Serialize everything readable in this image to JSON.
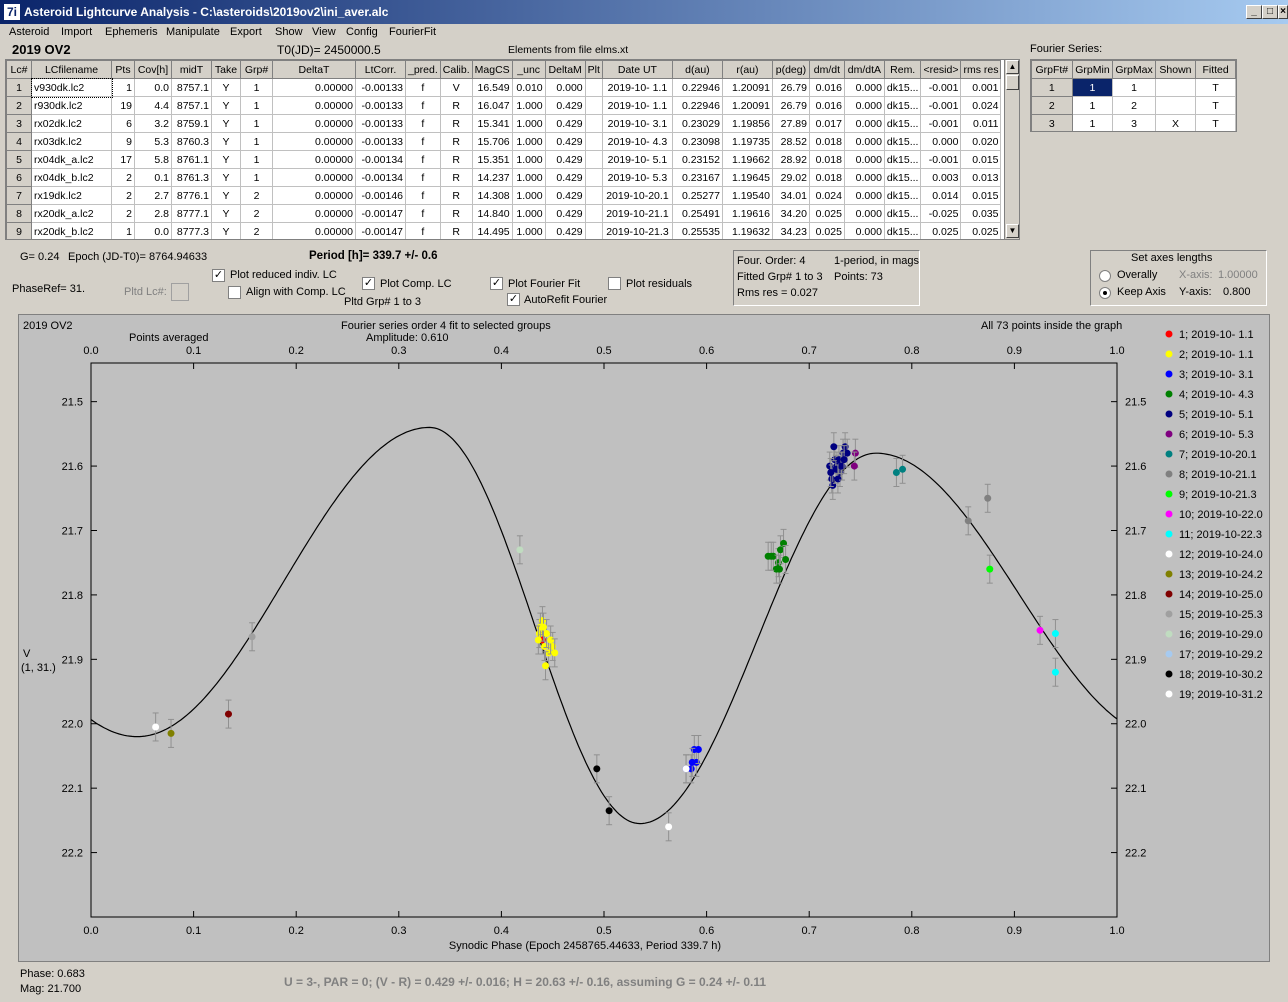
{
  "window": {
    "title": "Asteroid Lightcurve Analysis - C:\\asteroids\\2019ov2\\ini_aver.alc",
    "icon": "7i",
    "min": "_",
    "max": "□",
    "close": "×"
  },
  "menu": [
    "Asteroid",
    "Import",
    "Ephemeris",
    "Manipulate",
    "Export",
    "Show",
    "View",
    "Config",
    "FourierFit"
  ],
  "header": {
    "asteroid": "2019 OV2",
    "t0": "T0(JD)= 2450000.5",
    "elements": "Elements from file elms.xt",
    "fourier_series_label": "Fourier Series:"
  },
  "lc_table": {
    "columns": [
      "Lc#",
      "LCfilename",
      "Pts",
      "Cov[h]",
      "midT",
      "Take",
      "Grp#",
      "DeltaT",
      "LtCorr.",
      "_pred.",
      "Calib.",
      "MagCS",
      "_unc",
      "DeltaM",
      "Plt",
      "Date UT",
      "d(au)",
      "r(au)",
      "p(deg)",
      "dm/dt",
      "dm/dtA",
      "Rem.",
      "<resid>",
      "rms res"
    ],
    "rows": [
      [
        "1",
        "v930dk.lc2",
        "1",
        "0.0",
        "8757.1",
        "Y",
        "1",
        "0.00000",
        "-0.00133",
        "f",
        "V",
        "16.549",
        "0.010",
        "0.000",
        "",
        "2019-10- 1.1",
        "0.22946",
        "1.20091",
        "26.79",
        "0.016",
        "0.000",
        "dk15...",
        "-0.001",
        "0.001"
      ],
      [
        "2",
        "r930dk.lc2",
        "19",
        "4.4",
        "8757.1",
        "Y",
        "1",
        "0.00000",
        "-0.00133",
        "f",
        "R",
        "16.047",
        "1.000",
        "0.429",
        "",
        "2019-10- 1.1",
        "0.22946",
        "1.20091",
        "26.79",
        "0.016",
        "0.000",
        "dk15...",
        "-0.001",
        "0.024"
      ],
      [
        "3",
        "rx02dk.lc2",
        "6",
        "3.2",
        "8759.1",
        "Y",
        "1",
        "0.00000",
        "-0.00133",
        "f",
        "R",
        "15.341",
        "1.000",
        "0.429",
        "",
        "2019-10- 3.1",
        "0.23029",
        "1.19856",
        "27.89",
        "0.017",
        "0.000",
        "dk15...",
        "-0.001",
        "0.011"
      ],
      [
        "4",
        "rx03dk.lc2",
        "9",
        "5.3",
        "8760.3",
        "Y",
        "1",
        "0.00000",
        "-0.00133",
        "f",
        "R",
        "15.706",
        "1.000",
        "0.429",
        "",
        "2019-10- 4.3",
        "0.23098",
        "1.19735",
        "28.52",
        "0.018",
        "0.000",
        "dk15...",
        "0.000",
        "0.020"
      ],
      [
        "5",
        "rx04dk_a.lc2",
        "17",
        "5.8",
        "8761.1",
        "Y",
        "1",
        "0.00000",
        "-0.00134",
        "f",
        "R",
        "15.351",
        "1.000",
        "0.429",
        "",
        "2019-10- 5.1",
        "0.23152",
        "1.19662",
        "28.92",
        "0.018",
        "0.000",
        "dk15...",
        "-0.001",
        "0.015"
      ],
      [
        "6",
        "rx04dk_b.lc2",
        "2",
        "0.1",
        "8761.3",
        "Y",
        "1",
        "0.00000",
        "-0.00134",
        "f",
        "R",
        "14.237",
        "1.000",
        "0.429",
        "",
        "2019-10- 5.3",
        "0.23167",
        "1.19645",
        "29.02",
        "0.018",
        "0.000",
        "dk15...",
        "0.003",
        "0.013"
      ],
      [
        "7",
        "rx19dk.lc2",
        "2",
        "2.7",
        "8776.1",
        "Y",
        "2",
        "0.00000",
        "-0.00146",
        "f",
        "R",
        "14.308",
        "1.000",
        "0.429",
        "",
        "2019-10-20.1",
        "0.25277",
        "1.19540",
        "34.01",
        "0.024",
        "0.000",
        "dk15...",
        "0.014",
        "0.015"
      ],
      [
        "8",
        "rx20dk_a.lc2",
        "2",
        "2.8",
        "8777.1",
        "Y",
        "2",
        "0.00000",
        "-0.00147",
        "f",
        "R",
        "14.840",
        "1.000",
        "0.429",
        "",
        "2019-10-21.1",
        "0.25491",
        "1.19616",
        "34.20",
        "0.025",
        "0.000",
        "dk15...",
        "-0.025",
        "0.035"
      ],
      [
        "9",
        "rx20dk_b.lc2",
        "1",
        "0.0",
        "8777.3",
        "Y",
        "2",
        "0.00000",
        "-0.00147",
        "f",
        "R",
        "14.495",
        "1.000",
        "0.429",
        "",
        "2019-10-21.3",
        "0.25535",
        "1.19632",
        "34.23",
        "0.025",
        "0.000",
        "dk15...",
        "0.025",
        "0.025"
      ]
    ]
  },
  "fourier_table": {
    "columns": [
      "GrpFt#",
      "GrpMin",
      "GrpMax",
      "Shown",
      "Fitted"
    ],
    "rows": [
      [
        "1",
        "1",
        "1",
        "",
        "T"
      ],
      [
        "2",
        "1",
        "2",
        "",
        "T"
      ],
      [
        "3",
        "1",
        "3",
        "X",
        "T"
      ]
    ]
  },
  "controls": {
    "g": "G= 0.24",
    "epoch": "Epoch (JD-T0)= 8764.94633",
    "period": "Period [h]= 339.7 +/- 0.6",
    "phaseref": "PhaseRef= 31.",
    "pltd_lc": "Pltd Lc#:",
    "plot_reduced": "Plot reduced indiv. LC",
    "align_comp": "Align with Comp. LC",
    "plot_comp": "Plot Comp. LC",
    "pltd_grp": "Pltd Grp#  1   to   3",
    "plot_fourier": "Plot Fourier Fit",
    "autorefit": "AutoRefit Fourier",
    "plot_residuals": "Plot residuals",
    "check_mark": "✓"
  },
  "fourier_info": {
    "order": "Four. Order:  4",
    "period_mode": "1-period, in mags",
    "fitted": "Fitted Grp# 1 to 3",
    "points": "Points: 73",
    "rms": "Rms res     = 0.027"
  },
  "axes_box": {
    "title": "Set axes lengths",
    "overally": "Overally",
    "keep_axis": "Keep Axis",
    "xaxis_label": "X-axis:",
    "xaxis_value": "1.00000",
    "yaxis_label": "Y-axis:",
    "yaxis_value": "0.800"
  },
  "plot": {
    "name": "2019 OV2",
    "points_averaged": "Points averaged",
    "fit_title": "Fourier series order 4 fit to selected groups",
    "amplitude": "Amplitude: 0.610",
    "inside": "All 73 points inside the graph",
    "ylabel1": "V",
    "ylabel2": "(1, 31.)",
    "xlabel": "Synodic Phase (Epoch 2458765.44633, Period 339.7 h)"
  },
  "chart_data": {
    "type": "scatter",
    "xlim": [
      0,
      1
    ],
    "ylim": [
      22.3,
      21.44
    ],
    "y_inverted": true,
    "x_ticks": [
      "0.0",
      "0.1",
      "0.2",
      "0.3",
      "0.4",
      "0.5",
      "0.6",
      "0.7",
      "0.8",
      "0.9",
      "1.0"
    ],
    "y_ticks": [
      "21.5",
      "21.6",
      "21.7",
      "21.8",
      "21.9",
      "22.0",
      "22.1",
      "22.2"
    ],
    "series": [
      {
        "name": "1; 2019-10- 1.1",
        "color": "#ff0000",
        "points": [
          [
            0.44,
            21.87
          ]
        ]
      },
      {
        "name": "2; 2019-10- 1.1",
        "color": "#ffff00",
        "points": [
          [
            0.437,
            21.86
          ],
          [
            0.44,
            21.84
          ],
          [
            0.442,
            21.88
          ],
          [
            0.444,
            21.86
          ],
          [
            0.446,
            21.89
          ],
          [
            0.438,
            21.85
          ],
          [
            0.45,
            21.88
          ],
          [
            0.443,
            21.91
          ],
          [
            0.448,
            21.87
          ],
          [
            0.452,
            21.89
          ],
          [
            0.436,
            21.87
          ],
          [
            0.441,
            21.85
          ]
        ]
      },
      {
        "name": "3; 2019-10- 3.1",
        "color": "#0000ff",
        "points": [
          [
            0.58,
            22.07
          ],
          [
            0.585,
            22.07
          ],
          [
            0.59,
            22.06
          ],
          [
            0.588,
            22.04
          ],
          [
            0.592,
            22.04
          ],
          [
            0.586,
            22.06
          ]
        ]
      },
      {
        "name": "4; 2019-10- 4.3",
        "color": "#008000",
        "points": [
          [
            0.66,
            21.74
          ],
          [
            0.665,
            21.74
          ],
          [
            0.67,
            21.75
          ],
          [
            0.672,
            21.73
          ],
          [
            0.675,
            21.72
          ],
          [
            0.668,
            21.76
          ],
          [
            0.663,
            21.74
          ],
          [
            0.671,
            21.76
          ],
          [
            0.677,
            21.745
          ]
        ]
      },
      {
        "name": "5; 2019-10- 5.1",
        "color": "#000080",
        "points": [
          [
            0.72,
            21.6
          ],
          [
            0.722,
            21.62
          ],
          [
            0.725,
            21.59
          ],
          [
            0.727,
            21.6
          ],
          [
            0.73,
            21.61
          ],
          [
            0.733,
            21.58
          ],
          [
            0.735,
            21.57
          ],
          [
            0.723,
            21.63
          ],
          [
            0.726,
            21.605
          ],
          [
            0.729,
            21.59
          ],
          [
            0.731,
            21.6
          ],
          [
            0.737,
            21.58
          ],
          [
            0.721,
            21.61
          ],
          [
            0.724,
            21.57
          ],
          [
            0.728,
            21.62
          ],
          [
            0.732,
            21.6
          ],
          [
            0.734,
            21.59
          ]
        ]
      },
      {
        "name": "6; 2019-10- 5.3",
        "color": "#800080",
        "points": [
          [
            0.745,
            21.58
          ],
          [
            0.744,
            21.6
          ]
        ]
      },
      {
        "name": "7; 2019-10-20.1",
        "color": "#008080",
        "points": [
          [
            0.785,
            21.61
          ],
          [
            0.791,
            21.605
          ]
        ]
      },
      {
        "name": "8; 2019-10-21.1",
        "color": "#808080",
        "points": [
          [
            0.855,
            21.685
          ],
          [
            0.874,
            21.65
          ]
        ]
      },
      {
        "name": "9; 2019-10-21.3",
        "color": "#00ff00",
        "points": [
          [
            0.876,
            21.76
          ]
        ]
      },
      {
        "name": "10; 2019-10-22.0",
        "color": "#ff00ff",
        "points": [
          [
            0.925,
            21.855
          ]
        ]
      },
      {
        "name": "11; 2019-10-22.3",
        "color": "#00ffff",
        "points": [
          [
            0.94,
            21.86
          ],
          [
            0.94,
            21.92
          ]
        ]
      },
      {
        "name": "12; 2019-10-24.0",
        "color": "#ffffff",
        "points": [
          [
            0.063,
            22.005
          ],
          [
            0.58,
            22.07
          ],
          [
            0.563,
            22.16
          ]
        ]
      },
      {
        "name": "13; 2019-10-24.2",
        "color": "#808000",
        "points": [
          [
            0.078,
            22.015
          ]
        ]
      },
      {
        "name": "14; 2019-10-25.0",
        "color": "#800000",
        "points": [
          [
            0.134,
            21.985
          ]
        ]
      },
      {
        "name": "15; 2019-10-25.3",
        "color": "#a0a0a0",
        "points": [
          [
            0.157,
            21.865
          ]
        ]
      },
      {
        "name": "16; 2019-10-29.0",
        "color": "#c0dcc0",
        "points": [
          [
            0.418,
            21.73
          ]
        ]
      },
      {
        "name": "17; 2019-10-29.2",
        "color": "#a6caf0",
        "points": []
      },
      {
        "name": "18; 2019-10-30.2",
        "color": "#000000",
        "points": [
          [
            0.493,
            22.07
          ],
          [
            0.505,
            22.135
          ]
        ]
      },
      {
        "name": "19; 2019-10-31.2",
        "color": "#ffffff",
        "points": []
      }
    ],
    "fourier_fit": {
      "mean": 21.85,
      "amplitude": 0.61,
      "max_phase": 0.33,
      "max_mag": 21.54,
      "min_phase": 0.535,
      "min_mag": 22.155
    }
  },
  "status": {
    "phase": "Phase:  0.683",
    "mag": "Mag:    21.700",
    "summary": "U = 3-, PAR = 0; (V - R) = 0.429 +/- 0.016; H = 20.63 +/- 0.16, assuming G = 0.24 +/- 0.11"
  }
}
